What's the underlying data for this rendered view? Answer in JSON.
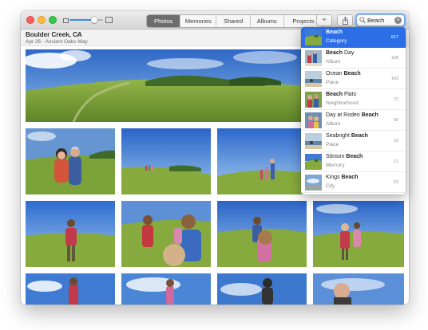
{
  "toolbar": {
    "zoom_level": 0.74,
    "tabs": [
      {
        "label": "Photos",
        "active": true
      },
      {
        "label": "Memories",
        "active": false
      },
      {
        "label": "Shared",
        "active": false
      },
      {
        "label": "Albums",
        "active": false
      },
      {
        "label": "Projects",
        "active": false
      }
    ],
    "add_icon": "plus-icon",
    "share_icon": "share-icon",
    "search": {
      "value": "Beach",
      "placeholder": "Search",
      "icon": "search-icon",
      "clear_icon": "clear-icon"
    }
  },
  "moment": {
    "title": "Boulder Creek, CA",
    "chevron": "›",
    "subtitle": "Apr 26 · Ancient Oaks Way"
  },
  "search_results": [
    {
      "name_before": "",
      "match": "Beach",
      "name_after": "",
      "type": "Category",
      "count": "617",
      "selected": true,
      "thumb": "hill"
    },
    {
      "name_before": "",
      "match": "Beach",
      "name_after": " Day",
      "type": "Album",
      "count": "168",
      "selected": false,
      "thumb": "people"
    },
    {
      "name_before": "Ocean ",
      "match": "Beach",
      "name_after": "",
      "type": "Place",
      "count": "143",
      "selected": false,
      "thumb": "coast"
    },
    {
      "name_before": "",
      "match": "Beach",
      "name_after": " Flats",
      "type": "Neighborhood",
      "count": "72",
      "selected": false,
      "thumb": "family"
    },
    {
      "name_before": "Day at Rodeo ",
      "match": "Beach",
      "name_after": "",
      "type": "Album",
      "count": "56",
      "selected": false,
      "thumb": "kids"
    },
    {
      "name_before": "Seabright ",
      "match": "Beach",
      "name_after": "",
      "type": "Place",
      "count": "19",
      "selected": false,
      "thumb": "coast"
    },
    {
      "name_before": "Stinson ",
      "match": "Beach",
      "name_after": "",
      "type": "Memory",
      "count": "11",
      "selected": false,
      "thumb": "hill"
    },
    {
      "name_before": "Kings ",
      "match": "Beach",
      "name_after": "",
      "type": "City",
      "count": "53",
      "selected": false,
      "thumb": "sky"
    }
  ],
  "colors": {
    "accent": "#2b6ee6",
    "sky": "#3f7fd6",
    "grass": "#86ac3e"
  }
}
